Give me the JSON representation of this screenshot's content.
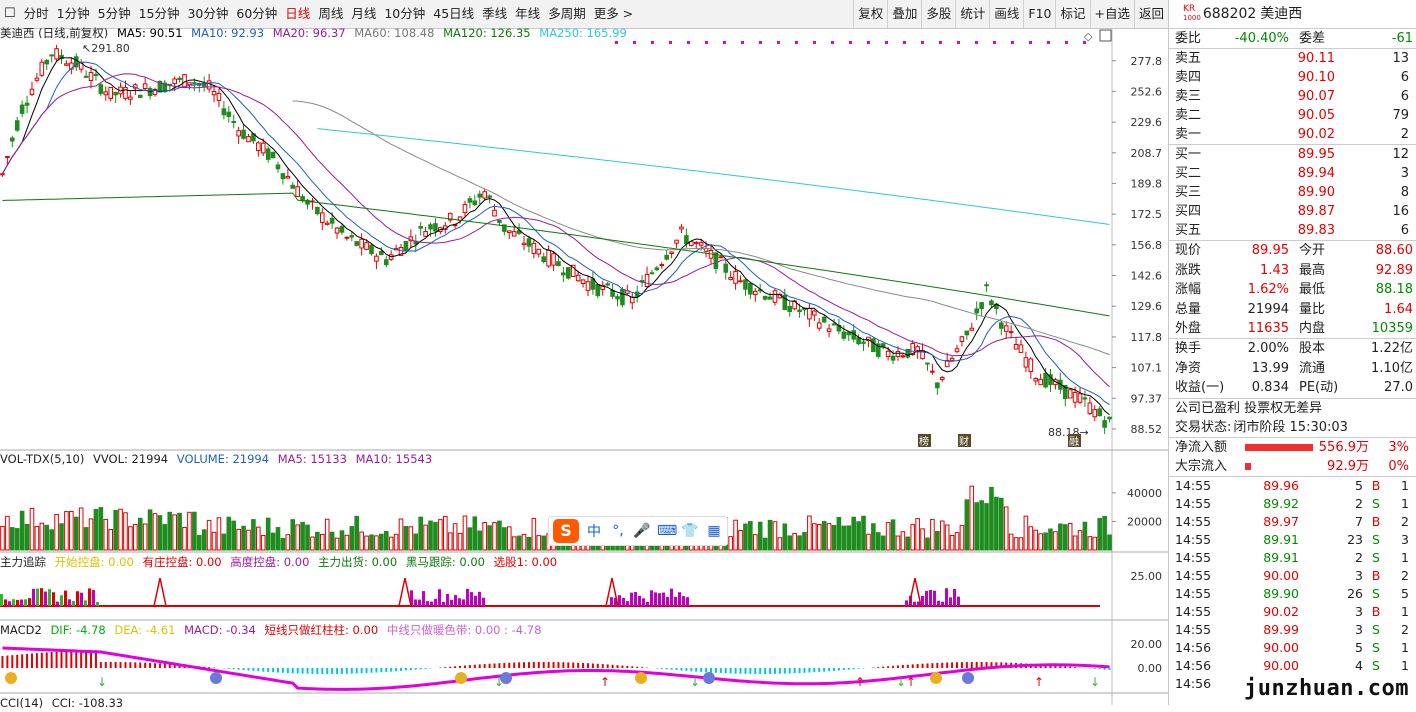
{
  "toolbar": {
    "periods": [
      "分时",
      "1分钟",
      "5分钟",
      "15分钟",
      "30分钟",
      "60分钟",
      "日线",
      "周线",
      "月线",
      "10分钟",
      "45日线",
      "季线",
      "年线",
      "多周期",
      "更多 >"
    ],
    "active": "日线",
    "right": [
      "复权",
      "叠加",
      "多股",
      "统计",
      "画线",
      "F10",
      "标记",
      "+自选",
      "返回"
    ]
  },
  "main_legend": {
    "title": "美迪西 (日线,前复权)",
    "ma5": "MA5: 90.51",
    "ma10": "MA10: 92.93",
    "ma20": "MA20: 96.37",
    "ma60": "MA60: 108.48",
    "ma120": "MA120: 126.35",
    "ma250": "MA250: 165.99"
  },
  "price_axis": [
    "277.8",
    "252.6",
    "229.6",
    "208.7",
    "189.8",
    "172.5",
    "156.8",
    "142.6",
    "129.6",
    "117.8",
    "107.1",
    "97.37",
    "88.52"
  ],
  "annotations": {
    "high": "291.80",
    "low": "88.18",
    "markers": [
      "榜",
      "财",
      "融"
    ]
  },
  "vol_legend": {
    "name": "VOL-TDX(5,10)",
    "vvol": "VVOL: 21994",
    "volume": "VOLUME: 21994",
    "ma5": "MA5: 15133",
    "ma10": "MA10: 15543"
  },
  "vol_axis": [
    "40000",
    "20000"
  ],
  "zl_legend": {
    "name": "主力追踪",
    "a": "开始控盘: 0.00",
    "b": "有庄控盘: 0.00",
    "c": "高度控盘: 0.00",
    "d": "主力出货: 0.00",
    "e": "黑马跟踪: 0.00",
    "f": "选股1: 0.00"
  },
  "zl_axis": [
    "25.00"
  ],
  "macd_legend": {
    "name": "MACD2",
    "dif": "DIF: -4.78",
    "dea": "DEA: -4.61",
    "macd": "MACD: -0.34",
    "s1": "短线只做红柱柱: 0.00",
    "s2": "中线只做暖色带: 0.00 : -4.78"
  },
  "macd_axis": [
    "20.00",
    "0.00"
  ],
  "cci_legend": {
    "name": "CCI(14)",
    "cci": "CCI: -108.33"
  },
  "quote": {
    "code": "688202",
    "name": "美迪西",
    "icon_top": "KR",
    "icon_bottom": "1000",
    "weibi_label": "委比",
    "weibi": "-40.40%",
    "weicha_label": "委差",
    "weicha": "-61",
    "asks": [
      {
        "label": "卖五",
        "price": "90.11",
        "vol": "13"
      },
      {
        "label": "卖四",
        "price": "90.10",
        "vol": "6"
      },
      {
        "label": "卖三",
        "price": "90.07",
        "vol": "6"
      },
      {
        "label": "卖二",
        "price": "90.05",
        "vol": "79"
      },
      {
        "label": "卖一",
        "price": "90.02",
        "vol": "2"
      }
    ],
    "bids": [
      {
        "label": "买一",
        "price": "89.95",
        "vol": "12"
      },
      {
        "label": "买二",
        "price": "89.94",
        "vol": "3"
      },
      {
        "label": "买三",
        "price": "89.90",
        "vol": "8"
      },
      {
        "label": "买四",
        "price": "89.87",
        "vol": "16"
      },
      {
        "label": "买五",
        "price": "89.83",
        "vol": "6"
      }
    ],
    "stats": [
      [
        "现价",
        "89.95",
        "red",
        "今开",
        "88.60",
        "red"
      ],
      [
        "涨跌",
        "1.43",
        "red",
        "最高",
        "92.89",
        "red"
      ],
      [
        "涨幅",
        "1.62%",
        "red",
        "最低",
        "88.18",
        "green"
      ],
      [
        "总量",
        "21994",
        "dark",
        "量比",
        "1.64",
        "red"
      ],
      [
        "外盘",
        "11635",
        "red",
        "内盘",
        "10359",
        "green"
      ]
    ],
    "stats2": [
      [
        "换手",
        "2.00%",
        "股本",
        "1.22亿"
      ],
      [
        "净资",
        "13.99",
        "流通",
        "1.10亿"
      ],
      [
        "收益(一)",
        "0.834",
        "PE(动)",
        "27.0"
      ]
    ],
    "note": "公司已盈利 投票权无差异",
    "status_label": "交易状态:",
    "status": "闭市阶段 15:30:03",
    "flow": [
      {
        "label": "净流入额",
        "value": "556.9万",
        "pct": "3%",
        "bar": 1.0
      },
      {
        "label": "大宗流入",
        "value": "92.9万",
        "pct": "0%",
        "bar": 0.08
      }
    ],
    "ticks": [
      [
        "14:55",
        "89.96",
        "5",
        "B",
        "1"
      ],
      [
        "14:55",
        "89.92",
        "2",
        "S",
        "1"
      ],
      [
        "14:55",
        "89.97",
        "7",
        "B",
        "2"
      ],
      [
        "14:55",
        "89.91",
        "23",
        "S",
        "3"
      ],
      [
        "14:55",
        "89.91",
        "2",
        "S",
        "1"
      ],
      [
        "14:55",
        "90.00",
        "3",
        "B",
        "2"
      ],
      [
        "14:55",
        "89.90",
        "26",
        "S",
        "5"
      ],
      [
        "14:55",
        "90.02",
        "3",
        "B",
        "1"
      ],
      [
        "14:55",
        "89.99",
        "3",
        "S",
        "2"
      ],
      [
        "14:56",
        "90.00",
        "5",
        "S",
        "1"
      ],
      [
        "14:56",
        "90.00",
        "4",
        "S",
        "1"
      ],
      [
        "14:56",
        "",
        "",
        "",
        ""
      ]
    ]
  },
  "watermark": "junzhuan.com",
  "colors": {
    "up": "#e60000",
    "down": "#1e8c1e",
    "ma5": "#000000",
    "ma10": "#1f5fbf",
    "ma20": "#9b1b9b",
    "ma60": "#8a8a8a",
    "ma120": "#0d7a0d",
    "ma250": "#2ec8d8"
  }
}
